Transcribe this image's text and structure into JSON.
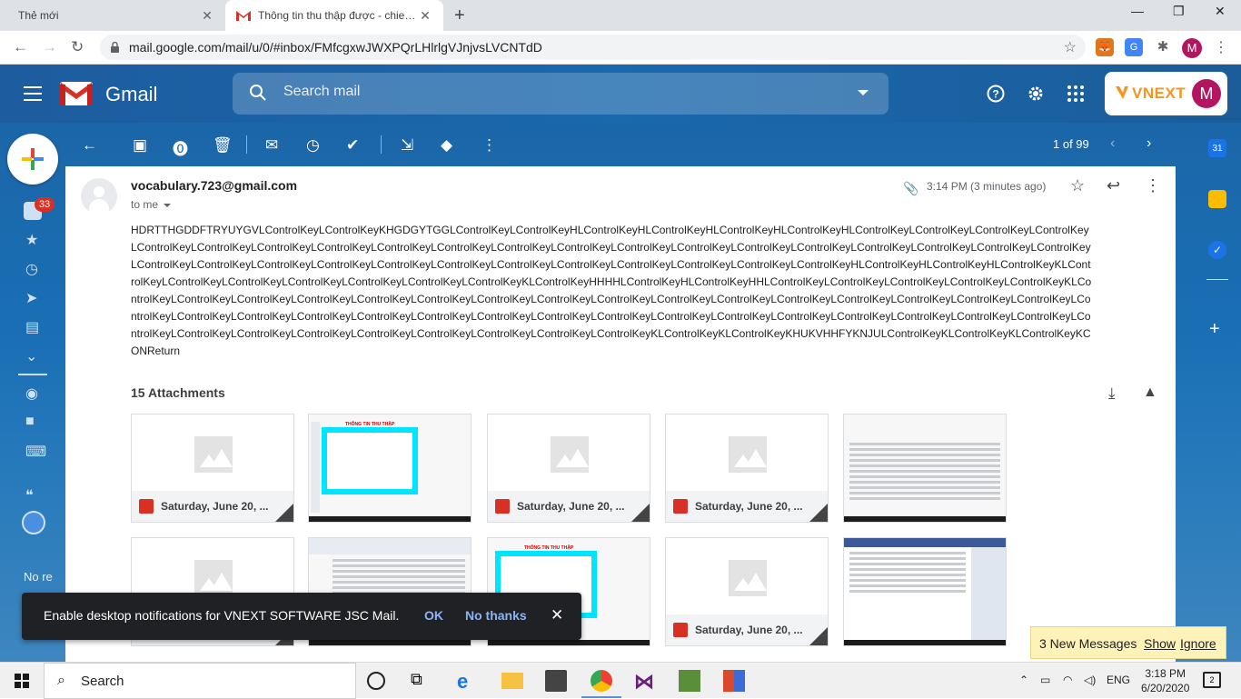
{
  "browser": {
    "tabs": [
      {
        "title": "Thẻ mới"
      },
      {
        "title": "Thông tin thu thập được - chiennd@vnext.vn - VNEXT SOFTWARE JSC Mail"
      }
    ],
    "url": "mail.google.com/mail/u/0/#inbox/FMfcgxwJWXPQrLHlrlgVJnjvsLVCNTdD",
    "profile_initial": "M"
  },
  "gmail": {
    "product_name": "Gmail",
    "search_placeholder": "Search mail",
    "brand_text": "VNEXT",
    "avatar_initial": "M",
    "inbox_badge": "33"
  },
  "toolbar": {
    "pager_text": "1 of 99"
  },
  "message": {
    "sender": "vocabulary.723@gmail.com",
    "to_me": "to me",
    "time": "3:14 PM (3 minutes ago)",
    "body": "HDRTTHGDDFTRYUYGVLControlKeyLControlKeyKHGDGYTGGLControlKeyLControlKeyHLControlKeyHLControlKeyHLControlKeyHLControlKeyHLControlKeyLControlKeyLControlKeyLControlKeyLControlKeyLControlKeyLControlKeyLControlKeyLControlKeyLControlKeyLControlKeyLControlKeyLControlKeyLControlKeyLControlKeyLControlKeyLControlKeyLControlKeyLControlKeyLControlKeyLControlKeyLControlKeyLControlKeyLControlKeyLControlKeyLControlKeyLControlKeyLControlKeyLControlKeyLControlKeyLControlKeyLControlKeyHLControlKeyHLControlKeyHLControlKeyKLControlKeyLControlKeyLControlKeyLControlKeyLControlKeyLControlKeyLControlKeyKLControlKeyHHHHLControlKeyHLControlKeyHHLControlKeyLControlKeyLControlKeyLControlKeyLControlKeyKLControlKeyLControlKeyLControlKeyLControlKeyLControlKeyLControlKeyLControlKeyLControlKeyLControlKeyLControlKeyLControlKeyLControlKeyLControlKeyLControlKeyLControlKeyLControlKeyLControlKeyLControlKeyLControlKeyLControlKeyLControlKeyLControlKeyLControlKeyLControlKeyLControlKeyLControlKeyLControlKeyLControlKeyLControlKeyLControlKeyLControlKeyLControlKeyLControlKeyLControlKeyLControlKeyLControlKeyLControlKeyLControlKeyLControlKeyLControlKeyLControlKeyKLControlKeyKLControlKeyKHUKVHHFYKNJULControlKeyKLControlKeyKLControlKeyKCONReturn",
    "attachments_title": "15 Attachments",
    "attachment_name": "Saturday, June 20, ..."
  },
  "screenshot_thumbs": {
    "header_text": "THÔNG TIN THU THẬP"
  },
  "snackbar": {
    "text": "Enable desktop notifications for VNEXT SOFTWARE JSC Mail.",
    "ok": "OK",
    "no_thanks": "No thanks"
  },
  "new_messages": {
    "text": "3 New Messages",
    "show": "Show",
    "ignore": "Ignore"
  },
  "left_rail": {
    "truncated_label": "No re"
  },
  "taskbar": {
    "search_label": "Search",
    "language": "ENG",
    "time": "3:18 PM",
    "date": "6/20/2020",
    "notification_count": "2"
  },
  "colors": {
    "accent_blue": "#1a68ad",
    "gmail_red": "#d93025",
    "brand_orange": "#f7941d",
    "avatar_magenta": "#b31561"
  }
}
